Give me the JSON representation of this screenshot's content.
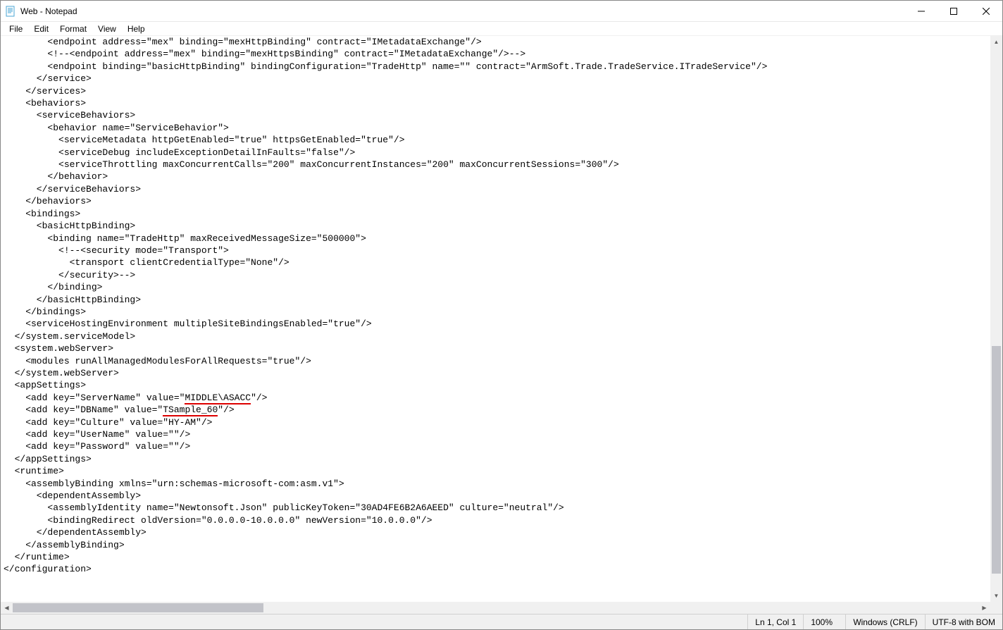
{
  "window": {
    "title": "Web - Notepad"
  },
  "menubar": {
    "file": "File",
    "edit": "Edit",
    "format": "Format",
    "view": "View",
    "help": "Help"
  },
  "editor": {
    "lines": [
      "        <endpoint address=\"mex\" binding=\"mexHttpBinding\" contract=\"IMetadataExchange\"/>",
      "        <!--<endpoint address=\"mex\" binding=\"mexHttpsBinding\" contract=\"IMetadataExchange\"/>-->",
      "        <endpoint binding=\"basicHttpBinding\" bindingConfiguration=\"TradeHttp\" name=\"\" contract=\"ArmSoft.Trade.TradeService.ITradeService\"/>",
      "      </service>",
      "    </services>",
      "    <behaviors>",
      "      <serviceBehaviors>",
      "        <behavior name=\"ServiceBehavior\">",
      "          <serviceMetadata httpGetEnabled=\"true\" httpsGetEnabled=\"true\"/>",
      "          <serviceDebug includeExceptionDetailInFaults=\"false\"/>",
      "          <serviceThrottling maxConcurrentCalls=\"200\" maxConcurrentInstances=\"200\" maxConcurrentSessions=\"300\"/>",
      "        </behavior>",
      "      </serviceBehaviors>",
      "    </behaviors>",
      "    <bindings>",
      "      <basicHttpBinding>",
      "        <binding name=\"TradeHttp\" maxReceivedMessageSize=\"500000\">",
      "          <!--<security mode=\"Transport\">",
      "            <transport clientCredentialType=\"None\"/>",
      "          </security>-->",
      "        </binding>",
      "      </basicHttpBinding>",
      "    </bindings>",
      "    <serviceHostingEnvironment multipleSiteBindingsEnabled=\"true\"/>",
      "  </system.serviceModel>",
      "  <system.webServer>",
      "    <modules runAllManagedModulesForAllRequests=\"true\"/>",
      "  </system.webServer>",
      "  <appSettings>",
      "    <add key=\"ServerName\" value=\"",
      "MIDDLE\\ASACC",
      "\"/>",
      "    <add key=\"DBName\" value=\"",
      "TSample_60",
      "\"/>",
      "    <add key=\"Culture\" value=\"HY-AM\"/>",
      "    <add key=\"UserName\" value=\"\"/>",
      "    <add key=\"Password\" value=\"\"/>",
      "  </appSettings>",
      "  <runtime>",
      "    <assemblyBinding xmlns=\"urn:schemas-microsoft-com:asm.v1\">",
      "      <dependentAssembly>",
      "        <assemblyIdentity name=\"Newtonsoft.Json\" publicKeyToken=\"30AD4FE6B2A6AEED\" culture=\"neutral\"/>",
      "        <bindingRedirect oldVersion=\"0.0.0.0-10.0.0.0\" newVersion=\"10.0.0.0\"/>",
      "      </dependentAssembly>",
      "    </assemblyBinding>",
      "  </runtime>",
      "</configuration>"
    ]
  },
  "statusbar": {
    "position": "Ln 1, Col 1",
    "zoom": "100%",
    "lineending": "Windows (CRLF)",
    "encoding": "UTF-8 with BOM"
  }
}
